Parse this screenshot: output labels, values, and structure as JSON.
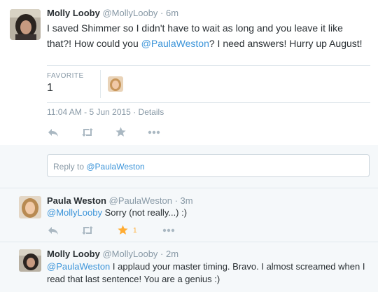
{
  "tweet_main": {
    "name": "Molly Looby",
    "handle": "@MollyLooby",
    "sep": "·",
    "time": "6m",
    "text_parts": [
      "I saved Shimmer so I didn't have to wait as long and you leave it like that?! How could you ",
      "@PaulaWeston",
      "? I need answers! Hurry up August!"
    ],
    "favorite_label": "FAVORITE",
    "favorite_count": "1",
    "timestamp": "11:04 AM - 5 Jun 2015",
    "ts_sep": "·",
    "details": "Details"
  },
  "reply_box": {
    "prefix": "Reply to ",
    "mention": "@PaulaWeston"
  },
  "reply1": {
    "name": "Paula Weston",
    "handle": "@PaulaWeston",
    "sep": "·",
    "time": "3m",
    "mention": "@MollyLooby",
    "text": " Sorry (not really...) :)",
    "fav_count": "1"
  },
  "reply2": {
    "name": "Molly Looby",
    "handle": "@MollyLooby",
    "sep": "·",
    "time": "2m",
    "mention": "@PaulaWeston",
    "text": " I applaud your master timing. Bravo. I almost screamed when I read that last sentence! You are a genius :)"
  },
  "colors": {
    "link": "#3b94d9",
    "fav_active": "#ffac33",
    "muted": "#8899a6",
    "icon_gray": "#aab8c2"
  }
}
